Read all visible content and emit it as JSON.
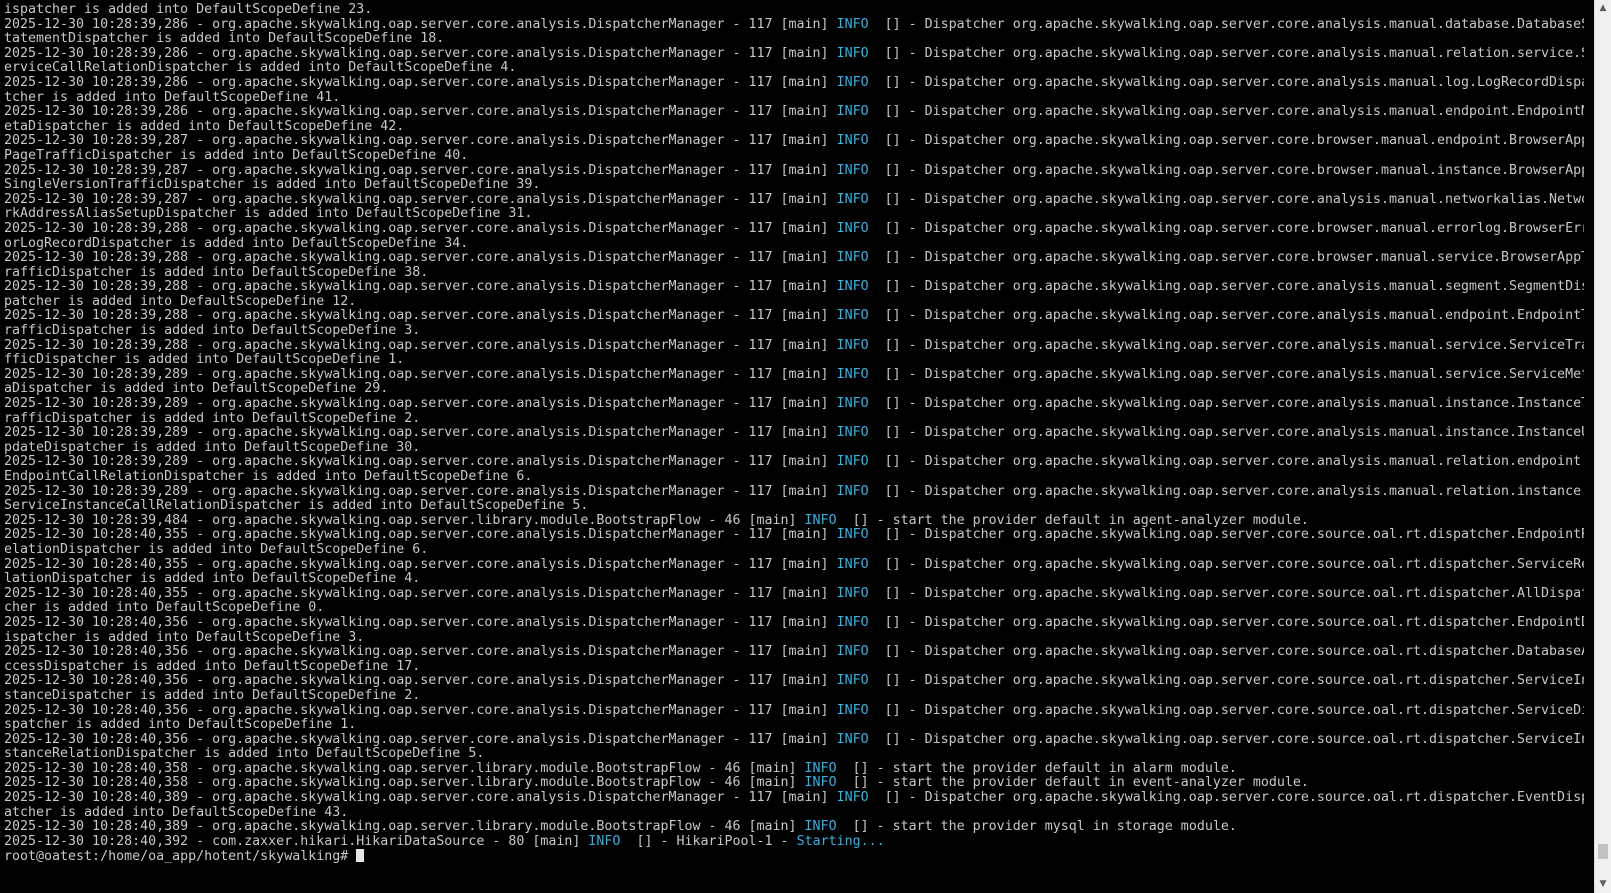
{
  "terminal": {
    "lines": [
      [
        {
          "t": "ispatcher is added into DefaultScopeDefine 23."
        }
      ],
      [
        {
          "t": "2025-12-30 10:28:39,286 - org.apache.skywalking.oap.server.core.analysis.DispatcherManager - 117 [main] "
        },
        {
          "t": "INFO",
          "c": "info"
        },
        {
          "t": "  [] - Dispatcher org.apache.skywalking.oap.server.core.analysis.manual.database.DatabaseS"
        }
      ],
      [
        {
          "t": "tatementDispatcher is added into DefaultScopeDefine 18."
        }
      ],
      [
        {
          "t": "2025-12-30 10:28:39,286 - org.apache.skywalking.oap.server.core.analysis.DispatcherManager - 117 [main] "
        },
        {
          "t": "INFO",
          "c": "info"
        },
        {
          "t": "  [] - Dispatcher org.apache.skywalking.oap.server.core.analysis.manual.relation.service.S"
        }
      ],
      [
        {
          "t": "erviceCallRelationDispatcher is added into DefaultScopeDefine 4."
        }
      ],
      [
        {
          "t": "2025-12-30 10:28:39,286 - org.apache.skywalking.oap.server.core.analysis.DispatcherManager - 117 [main] "
        },
        {
          "t": "INFO",
          "c": "info"
        },
        {
          "t": "  [] - Dispatcher org.apache.skywalking.oap.server.core.analysis.manual.log.LogRecordDispa"
        }
      ],
      [
        {
          "t": "tcher is added into DefaultScopeDefine 41."
        }
      ],
      [
        {
          "t": "2025-12-30 10:28:39,286 - org.apache.skywalking.oap.server.core.analysis.DispatcherManager - 117 [main] "
        },
        {
          "t": "INFO",
          "c": "info"
        },
        {
          "t": "  [] - Dispatcher org.apache.skywalking.oap.server.core.analysis.manual.endpoint.EndpointM"
        }
      ],
      [
        {
          "t": "etaDispatcher is added into DefaultScopeDefine 42."
        }
      ],
      [
        {
          "t": "2025-12-30 10:28:39,287 - org.apache.skywalking.oap.server.core.analysis.DispatcherManager - 117 [main] "
        },
        {
          "t": "INFO",
          "c": "info"
        },
        {
          "t": "  [] - Dispatcher org.apache.skywalking.oap.server.core.browser.manual.endpoint.BrowserApp"
        }
      ],
      [
        {
          "t": "PageTrafficDispatcher is added into DefaultScopeDefine 40."
        }
      ],
      [
        {
          "t": "2025-12-30 10:28:39,287 - org.apache.skywalking.oap.server.core.analysis.DispatcherManager - 117 [main] "
        },
        {
          "t": "INFO",
          "c": "info"
        },
        {
          "t": "  [] - Dispatcher org.apache.skywalking.oap.server.core.browser.manual.instance.BrowserApp"
        }
      ],
      [
        {
          "t": "SingleVersionTrafficDispatcher is added into DefaultScopeDefine 39."
        }
      ],
      [
        {
          "t": "2025-12-30 10:28:39,287 - org.apache.skywalking.oap.server.core.analysis.DispatcherManager - 117 [main] "
        },
        {
          "t": "INFO",
          "c": "info"
        },
        {
          "t": "  [] - Dispatcher org.apache.skywalking.oap.server.core.analysis.manual.networkalias.Netwo"
        }
      ],
      [
        {
          "t": "rkAddressAliasSetupDispatcher is added into DefaultScopeDefine 31."
        }
      ],
      [
        {
          "t": "2025-12-30 10:28:39,288 - org.apache.skywalking.oap.server.core.analysis.DispatcherManager - 117 [main] "
        },
        {
          "t": "INFO",
          "c": "info"
        },
        {
          "t": "  [] - Dispatcher org.apache.skywalking.oap.server.core.browser.manual.errorlog.BrowserErr"
        }
      ],
      [
        {
          "t": "orLogRecordDispatcher is added into DefaultScopeDefine 34."
        }
      ],
      [
        {
          "t": "2025-12-30 10:28:39,288 - org.apache.skywalking.oap.server.core.analysis.DispatcherManager - 117 [main] "
        },
        {
          "t": "INFO",
          "c": "info"
        },
        {
          "t": "  [] - Dispatcher org.apache.skywalking.oap.server.core.browser.manual.service.BrowserAppT"
        }
      ],
      [
        {
          "t": "rafficDispatcher is added into DefaultScopeDefine 38."
        }
      ],
      [
        {
          "t": "2025-12-30 10:28:39,288 - org.apache.skywalking.oap.server.core.analysis.DispatcherManager - 117 [main] "
        },
        {
          "t": "INFO",
          "c": "info"
        },
        {
          "t": "  [] - Dispatcher org.apache.skywalking.oap.server.core.analysis.manual.segment.SegmentDis"
        }
      ],
      [
        {
          "t": "patcher is added into DefaultScopeDefine 12."
        }
      ],
      [
        {
          "t": "2025-12-30 10:28:39,288 - org.apache.skywalking.oap.server.core.analysis.DispatcherManager - 117 [main] "
        },
        {
          "t": "INFO",
          "c": "info"
        },
        {
          "t": "  [] - Dispatcher org.apache.skywalking.oap.server.core.analysis.manual.endpoint.EndpointT"
        }
      ],
      [
        {
          "t": "rafficDispatcher is added into DefaultScopeDefine 3."
        }
      ],
      [
        {
          "t": "2025-12-30 10:28:39,288 - org.apache.skywalking.oap.server.core.analysis.DispatcherManager - 117 [main] "
        },
        {
          "t": "INFO",
          "c": "info"
        },
        {
          "t": "  [] - Dispatcher org.apache.skywalking.oap.server.core.analysis.manual.service.ServiceTra"
        }
      ],
      [
        {
          "t": "fficDispatcher is added into DefaultScopeDefine 1."
        }
      ],
      [
        {
          "t": "2025-12-30 10:28:39,289 - org.apache.skywalking.oap.server.core.analysis.DispatcherManager - 117 [main] "
        },
        {
          "t": "INFO",
          "c": "info"
        },
        {
          "t": "  [] - Dispatcher org.apache.skywalking.oap.server.core.analysis.manual.service.ServiceMet"
        }
      ],
      [
        {
          "t": "aDispatcher is added into DefaultScopeDefine 29."
        }
      ],
      [
        {
          "t": "2025-12-30 10:28:39,289 - org.apache.skywalking.oap.server.core.analysis.DispatcherManager - 117 [main] "
        },
        {
          "t": "INFO",
          "c": "info"
        },
        {
          "t": "  [] - Dispatcher org.apache.skywalking.oap.server.core.analysis.manual.instance.InstanceT"
        }
      ],
      [
        {
          "t": "rafficDispatcher is added into DefaultScopeDefine 2."
        }
      ],
      [
        {
          "t": "2025-12-30 10:28:39,289 - org.apache.skywalking.oap.server.core.analysis.DispatcherManager - 117 [main] "
        },
        {
          "t": "INFO",
          "c": "info"
        },
        {
          "t": "  [] - Dispatcher org.apache.skywalking.oap.server.core.analysis.manual.instance.InstanceU"
        }
      ],
      [
        {
          "t": "pdateDispatcher is added into DefaultScopeDefine 30."
        }
      ],
      [
        {
          "t": "2025-12-30 10:28:39,289 - org.apache.skywalking.oap.server.core.analysis.DispatcherManager - 117 [main] "
        },
        {
          "t": "INFO",
          "c": "info"
        },
        {
          "t": "  [] - Dispatcher org.apache.skywalking.oap.server.core.analysis.manual.relation.endpoint."
        }
      ],
      [
        {
          "t": "EndpointCallRelationDispatcher is added into DefaultScopeDefine 6."
        }
      ],
      [
        {
          "t": "2025-12-30 10:28:39,289 - org.apache.skywalking.oap.server.core.analysis.DispatcherManager - 117 [main] "
        },
        {
          "t": "INFO",
          "c": "info"
        },
        {
          "t": "  [] - Dispatcher org.apache.skywalking.oap.server.core.analysis.manual.relation.instance."
        }
      ],
      [
        {
          "t": "ServiceInstanceCallRelationDispatcher is added into DefaultScopeDefine 5."
        }
      ],
      [
        {
          "t": "2025-12-30 10:28:39,484 - org.apache.skywalking.oap.server.library.module.BootstrapFlow - 46 [main] "
        },
        {
          "t": "INFO",
          "c": "info"
        },
        {
          "t": "  [] - start the provider default in agent-analyzer module."
        }
      ],
      [
        {
          "t": "2025-12-30 10:28:40,355 - org.apache.skywalking.oap.server.core.analysis.DispatcherManager - 117 [main] "
        },
        {
          "t": "INFO",
          "c": "info"
        },
        {
          "t": "  [] - Dispatcher org.apache.skywalking.oap.server.core.source.oal.rt.dispatcher.EndpointR"
        }
      ],
      [
        {
          "t": "elationDispatcher is added into DefaultScopeDefine 6."
        }
      ],
      [
        {
          "t": "2025-12-30 10:28:40,355 - org.apache.skywalking.oap.server.core.analysis.DispatcherManager - 117 [main] "
        },
        {
          "t": "INFO",
          "c": "info"
        },
        {
          "t": "  [] - Dispatcher org.apache.skywalking.oap.server.core.source.oal.rt.dispatcher.ServiceRe"
        }
      ],
      [
        {
          "t": "lationDispatcher is added into DefaultScopeDefine 4."
        }
      ],
      [
        {
          "t": "2025-12-30 10:28:40,355 - org.apache.skywalking.oap.server.core.analysis.DispatcherManager - 117 [main] "
        },
        {
          "t": "INFO",
          "c": "info"
        },
        {
          "t": "  [] - Dispatcher org.apache.skywalking.oap.server.core.source.oal.rt.dispatcher.AllDispat"
        }
      ],
      [
        {
          "t": "cher is added into DefaultScopeDefine 0."
        }
      ],
      [
        {
          "t": "2025-12-30 10:28:40,356 - org.apache.skywalking.oap.server.core.analysis.DispatcherManager - 117 [main] "
        },
        {
          "t": "INFO",
          "c": "info"
        },
        {
          "t": "  [] - Dispatcher org.apache.skywalking.oap.server.core.source.oal.rt.dispatcher.EndpointD"
        }
      ],
      [
        {
          "t": "ispatcher is added into DefaultScopeDefine 3."
        }
      ],
      [
        {
          "t": "2025-12-30 10:28:40,356 - org.apache.skywalking.oap.server.core.analysis.DispatcherManager - 117 [main] "
        },
        {
          "t": "INFO",
          "c": "info"
        },
        {
          "t": "  [] - Dispatcher org.apache.skywalking.oap.server.core.source.oal.rt.dispatcher.DatabaseA"
        }
      ],
      [
        {
          "t": "ccessDispatcher is added into DefaultScopeDefine 17."
        }
      ],
      [
        {
          "t": "2025-12-30 10:28:40,356 - org.apache.skywalking.oap.server.core.analysis.DispatcherManager - 117 [main] "
        },
        {
          "t": "INFO",
          "c": "info"
        },
        {
          "t": "  [] - Dispatcher org.apache.skywalking.oap.server.core.source.oal.rt.dispatcher.ServiceIn"
        }
      ],
      [
        {
          "t": "stanceDispatcher is added into DefaultScopeDefine 2."
        }
      ],
      [
        {
          "t": "2025-12-30 10:28:40,356 - org.apache.skywalking.oap.server.core.analysis.DispatcherManager - 117 [main] "
        },
        {
          "t": "INFO",
          "c": "info"
        },
        {
          "t": "  [] - Dispatcher org.apache.skywalking.oap.server.core.source.oal.rt.dispatcher.ServiceDi"
        }
      ],
      [
        {
          "t": "spatcher is added into DefaultScopeDefine 1."
        }
      ],
      [
        {
          "t": "2025-12-30 10:28:40,356 - org.apache.skywalking.oap.server.core.analysis.DispatcherManager - 117 [main] "
        },
        {
          "t": "INFO",
          "c": "info"
        },
        {
          "t": "  [] - Dispatcher org.apache.skywalking.oap.server.core.source.oal.rt.dispatcher.ServiceIn"
        }
      ],
      [
        {
          "t": "stanceRelationDispatcher is added into DefaultScopeDefine 5."
        }
      ],
      [
        {
          "t": "2025-12-30 10:28:40,358 - org.apache.skywalking.oap.server.library.module.BootstrapFlow - 46 [main] "
        },
        {
          "t": "INFO",
          "c": "info"
        },
        {
          "t": "  [] - start the provider default in alarm module."
        }
      ],
      [
        {
          "t": "2025-12-30 10:28:40,358 - org.apache.skywalking.oap.server.library.module.BootstrapFlow - 46 [main] "
        },
        {
          "t": "INFO",
          "c": "info"
        },
        {
          "t": "  [] - start the provider default in event-analyzer module."
        }
      ],
      [
        {
          "t": "2025-12-30 10:28:40,389 - org.apache.skywalking.oap.server.core.analysis.DispatcherManager - 117 [main] "
        },
        {
          "t": "INFO",
          "c": "info"
        },
        {
          "t": "  [] - Dispatcher org.apache.skywalking.oap.server.core.source.oal.rt.dispatcher.EventDisp"
        }
      ],
      [
        {
          "t": "atcher is added into DefaultScopeDefine 43."
        }
      ],
      [
        {
          "t": "2025-12-30 10:28:40,389 - org.apache.skywalking.oap.server.library.module.BootstrapFlow - 46 [main] "
        },
        {
          "t": "INFO",
          "c": "info"
        },
        {
          "t": "  [] - start the provider mysql in storage module."
        }
      ],
      [
        {
          "t": "2025-12-30 10:28:40,392 - com.zaxxer.hikari.HikariDataSource - 80 [main] "
        },
        {
          "t": "INFO",
          "c": "info"
        },
        {
          "t": "  [] - HikariPool-1 - "
        },
        {
          "t": "Starting...",
          "c": "cyan"
        }
      ]
    ],
    "prompt": "root@oatest:/home/oa_app/hotent/skywalking# ",
    "colors": {
      "background": "#000000",
      "foreground": "#c8c8c8",
      "info": "#2fb4e6"
    }
  },
  "scrollbar": {
    "up_icon": "chevron-up-icon",
    "down_icon": "chevron-down-icon",
    "position": 0.98
  }
}
